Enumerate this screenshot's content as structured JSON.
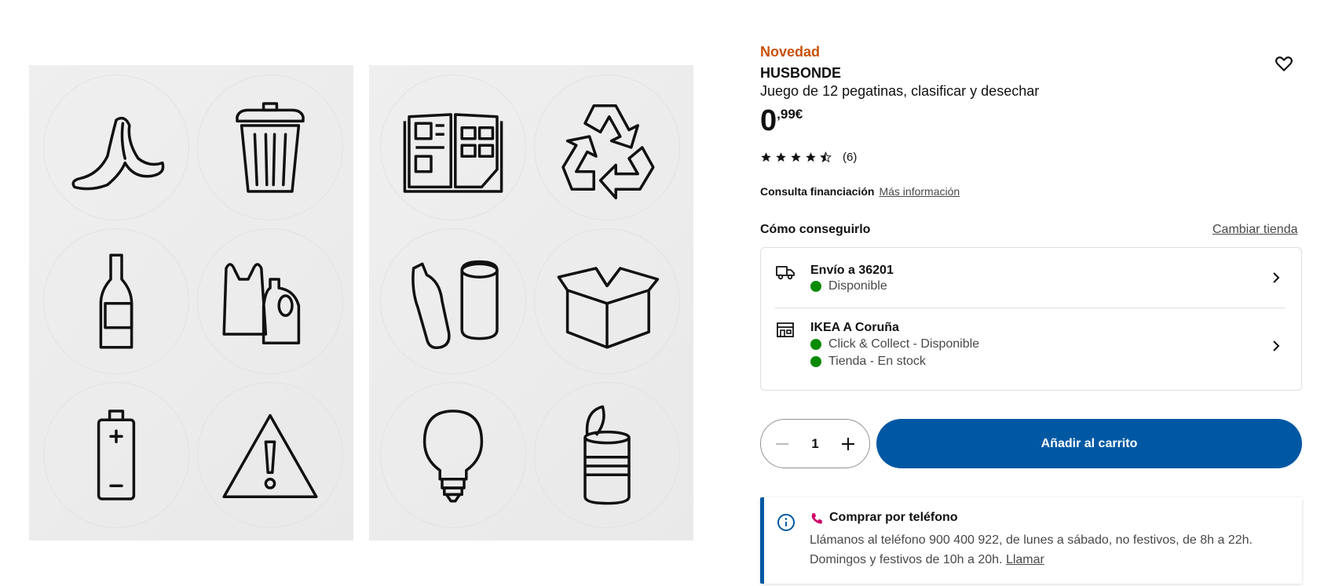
{
  "gallery": {
    "left_sheet_icons": [
      "banana-peel-icon",
      "trash-bin-icon",
      "glass-bottle-icon",
      "plastic-bag-bottle-icon",
      "battery-icon",
      "warning-triangle-icon"
    ],
    "right_sheet_icons": [
      "newspaper-icon",
      "recycle-icon",
      "plastic-bottle-can-icon",
      "cardboard-box-icon",
      "light-bulb-icon",
      "tin-can-icon"
    ]
  },
  "product": {
    "badge": "Novedad",
    "name": "HUSBONDE",
    "description": "Juego de 12 pegatinas, clasificar y desechar",
    "price_int": "0",
    "price_dec": ",99€",
    "rating_value": 4.5,
    "rating_count": "(6)"
  },
  "financing": {
    "label": "Consulta financiación",
    "link": "Más información"
  },
  "availability": {
    "heading": "Cómo conseguirlo",
    "change_store": "Cambiar tienda",
    "delivery": {
      "title": "Envío a 36201",
      "status": "Disponible"
    },
    "store": {
      "title": "IKEA A Coruña",
      "status1": "Click & Collect - Disponible",
      "status2": "Tienda - En stock"
    },
    "status_color": "#0a8a00"
  },
  "cart": {
    "quantity": "1",
    "add_label": "Añadir al carrito",
    "accent": "#0058a3"
  },
  "phone": {
    "title": "Comprar por teléfono",
    "text": "Llámanos al teléfono 900 400 922, de lunes a sábado, no festivos, de 8h a 22h. Domingos y festivos de 10h a 20h.",
    "link": "Llamar"
  }
}
